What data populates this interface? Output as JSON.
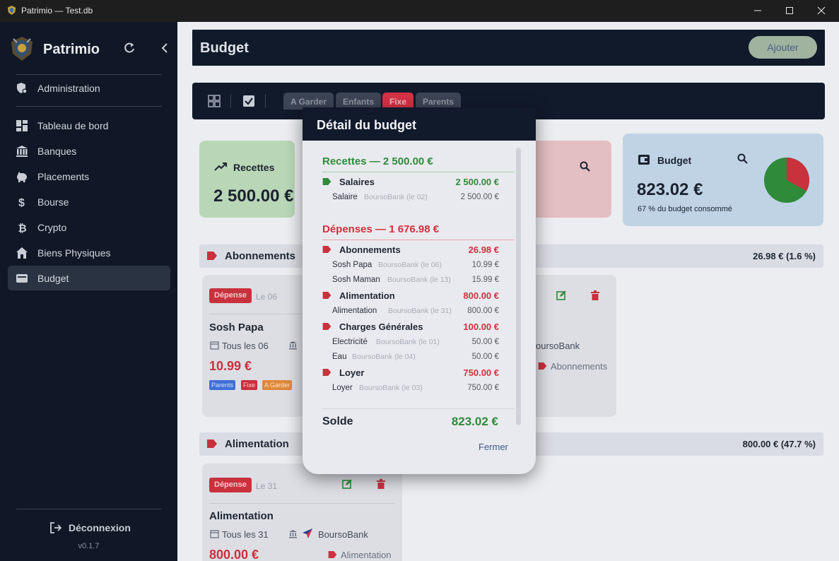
{
  "window": {
    "title": "Patrimio — Test.db"
  },
  "sidebar": {
    "brand": "Patrimio",
    "admin": "Administration",
    "items": [
      {
        "label": "Tableau de bord",
        "icon": "dashboard-icon"
      },
      {
        "label": "Banques",
        "icon": "bank-icon"
      },
      {
        "label": "Placements",
        "icon": "piggy-bank-icon"
      },
      {
        "label": "Bourse",
        "icon": "dollar-icon"
      },
      {
        "label": "Crypto",
        "icon": "bitcoin-icon"
      },
      {
        "label": "Biens Physiques",
        "icon": "home-icon"
      },
      {
        "label": "Budget",
        "icon": "wallet-icon"
      }
    ],
    "logout": "Déconnexion",
    "version": "v0.1.7"
  },
  "header": {
    "title": "Budget",
    "add_label": "Ajouter"
  },
  "toolbar": {
    "chips": [
      "A Garder",
      "Enfants",
      "Fixe",
      "Parents"
    ]
  },
  "summary": {
    "recettes_label": "Recettes",
    "recettes_value": "2 500.00 €",
    "budget_label": "Budget",
    "budget_value": "823.02 €",
    "budget_consumed": "67 % du budget consommé",
    "budget_consumed_fraction": 0.67
  },
  "sections": [
    {
      "name": "Abonnements",
      "total": "26.98 €  (1.6 %)"
    },
    {
      "name": "Alimentation",
      "total": "800.00 €  (47.7 %)"
    }
  ],
  "cards": {
    "sosh": {
      "badge": "Dépense",
      "day": "Le 06",
      "name": "Sosh Papa",
      "recurrence": "Tous les 06",
      "amount": "10.99 €",
      "tags": [
        "Parents",
        "Fixe",
        "A Garder"
      ]
    },
    "sosh2": {
      "bank": "oursoBank",
      "category": "Abonnements"
    },
    "alim": {
      "badge": "Dépense",
      "day": "Le 31",
      "name": "Alimentation",
      "recurrence": "Tous les 31",
      "bank": "BoursoBank",
      "amount": "800.00 €",
      "category": "Alimentation"
    }
  },
  "modal": {
    "title": "Détail du budget",
    "recettes_title": "Recettes — 2 500.00 €",
    "depenses_title": "Dépenses — 1 676.98 €",
    "recettes": [
      {
        "category": "Salaires",
        "amount": "2 500.00 €",
        "lines": [
          {
            "name": "Salaire",
            "source": "BoursoBank (le 02)",
            "amount": "2 500.00 €"
          }
        ]
      }
    ],
    "depenses": [
      {
        "category": "Abonnements",
        "amount": "26.98 €",
        "lines": [
          {
            "name": "Sosh Papa",
            "source": "BoursoBank (le 06)",
            "amount": "10.99 €"
          },
          {
            "name": "Sosh Maman",
            "source": "BoursoBank (le 13)",
            "amount": "15.99 €"
          }
        ]
      },
      {
        "category": "Alimentation",
        "amount": "800.00 €",
        "lines": [
          {
            "name": "Alimentation",
            "source": "BoursoBank (le 31)",
            "amount": "800.00 €"
          }
        ]
      },
      {
        "category": "Charges Générales",
        "amount": "100.00 €",
        "lines": [
          {
            "name": "Electricité",
            "source": "BoursoBank (le 01)",
            "amount": "50.00 €"
          },
          {
            "name": "Eau",
            "source": "BoursoBank (le 04)",
            "amount": "50.00 €"
          }
        ]
      },
      {
        "category": "Loyer",
        "amount": "750.00 €",
        "lines": [
          {
            "name": "Loyer",
            "source": "BoursoBank (le 03)",
            "amount": "750.00 €"
          }
        ]
      }
    ],
    "solde_label": "Solde",
    "solde_value": "823.02 €",
    "close_label": "Fermer"
  },
  "colors": {
    "green": "#2f8a3a",
    "red": "#d0313d",
    "navy": "#111a2b"
  }
}
